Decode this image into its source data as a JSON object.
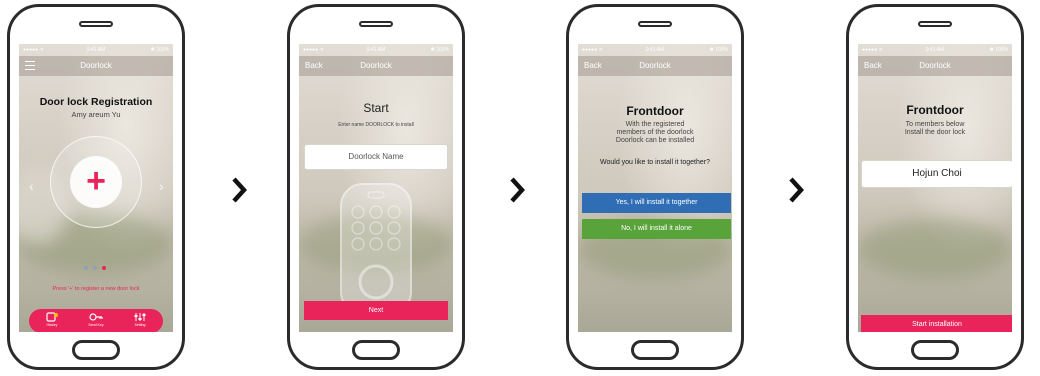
{
  "status": {
    "signal": "●●●●● ᯤ",
    "time": "9:41 AM",
    "battery": "✱ 100%"
  },
  "screen1": {
    "nav_title": "Doorlock",
    "heading": "Door lock Registration",
    "user": "Amy areum Yu",
    "plus": "+",
    "hint_prefix": "Press '",
    "hint_plus": "+",
    "hint_suffix": "' to register a new door lock",
    "tabs": [
      {
        "label": "History",
        "icon": "history-icon"
      },
      {
        "label": "Send Key",
        "icon": "key-icon"
      },
      {
        "label": "Setting",
        "icon": "setting-icon"
      }
    ]
  },
  "screen2": {
    "back": "Back",
    "nav_title": "Doorlock",
    "heading": "Start",
    "instruction": "Enter name DOORLOCK to install",
    "input_placeholder": "Doorlock Name",
    "next": "Next"
  },
  "screen3": {
    "back": "Back",
    "nav_title": "Doorlock",
    "heading": "Frontdoor",
    "line1": "With the registered",
    "line2": "members of the doorlock",
    "line3": "Doorlock can be installed",
    "question": "Would you like to install it together?",
    "yes": "Yes, I will install it together",
    "no": "No, I will install it alone"
  },
  "screen4": {
    "back": "Back",
    "nav_title": "Doorlock",
    "heading": "Frontdoor",
    "line1": "To members below",
    "line2": "Install the door lock",
    "member": "Hojun Choi",
    "start": "Start installation"
  },
  "colors": {
    "accent": "#e8245a",
    "blue": "#2f6db5",
    "green": "#58a33a",
    "dot_active": "#e8245a",
    "dot_inactive": "#8aa3b8"
  }
}
